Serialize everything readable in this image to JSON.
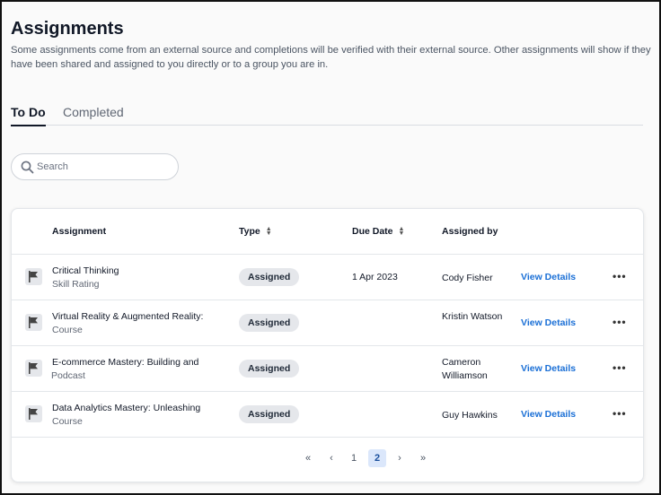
{
  "page": {
    "title": "Assignments",
    "description": "Some assignments come from an external source and completions will be verified with their external source. Other assignments will show if they have been shared and assigned to you directly or to a group you are in."
  },
  "tabs": [
    {
      "label": "To Do",
      "active": true
    },
    {
      "label": "Completed",
      "active": false
    }
  ],
  "search": {
    "placeholder": "Search",
    "icon": "search-icon"
  },
  "table": {
    "columns": {
      "assignment": "Assignment",
      "type": "Type",
      "due_date": "Due Date",
      "assigned_by": "Assigned by"
    },
    "rows": [
      {
        "name": "Critical Thinking",
        "category": "Skill Rating",
        "type": "Assigned",
        "due": "1 Apr 2023",
        "assigned_by": "Cody Fisher",
        "action": "View Details",
        "icon": "flag-icon"
      },
      {
        "name": "Virtual Reality & Augmented Reality:",
        "category": "Course",
        "type": "Assigned",
        "due": "",
        "assigned_by": "Kristin Watson",
        "action": "View Details",
        "icon": "flag-icon"
      },
      {
        "name": "E-commerce Mastery: Building and",
        "category": "Podcast",
        "type": "Assigned",
        "due": "",
        "assigned_by": "Cameron Williamson",
        "action": "View Details",
        "icon": "flag-icon"
      },
      {
        "name": "Data Analytics Mastery: Unleashing",
        "category": "Course",
        "type": "Assigned",
        "due": "",
        "assigned_by": "Guy Hawkins",
        "action": "View Details",
        "icon": "flag-icon"
      }
    ]
  },
  "pagination": {
    "first": "«",
    "prev": "‹",
    "pages": [
      "1",
      "2"
    ],
    "current": "2",
    "next": "›",
    "last": "»"
  },
  "colors": {
    "link": "#1a6fd6",
    "badge_bg": "#e5e7eb",
    "active_page_bg": "#dbe7fb"
  }
}
